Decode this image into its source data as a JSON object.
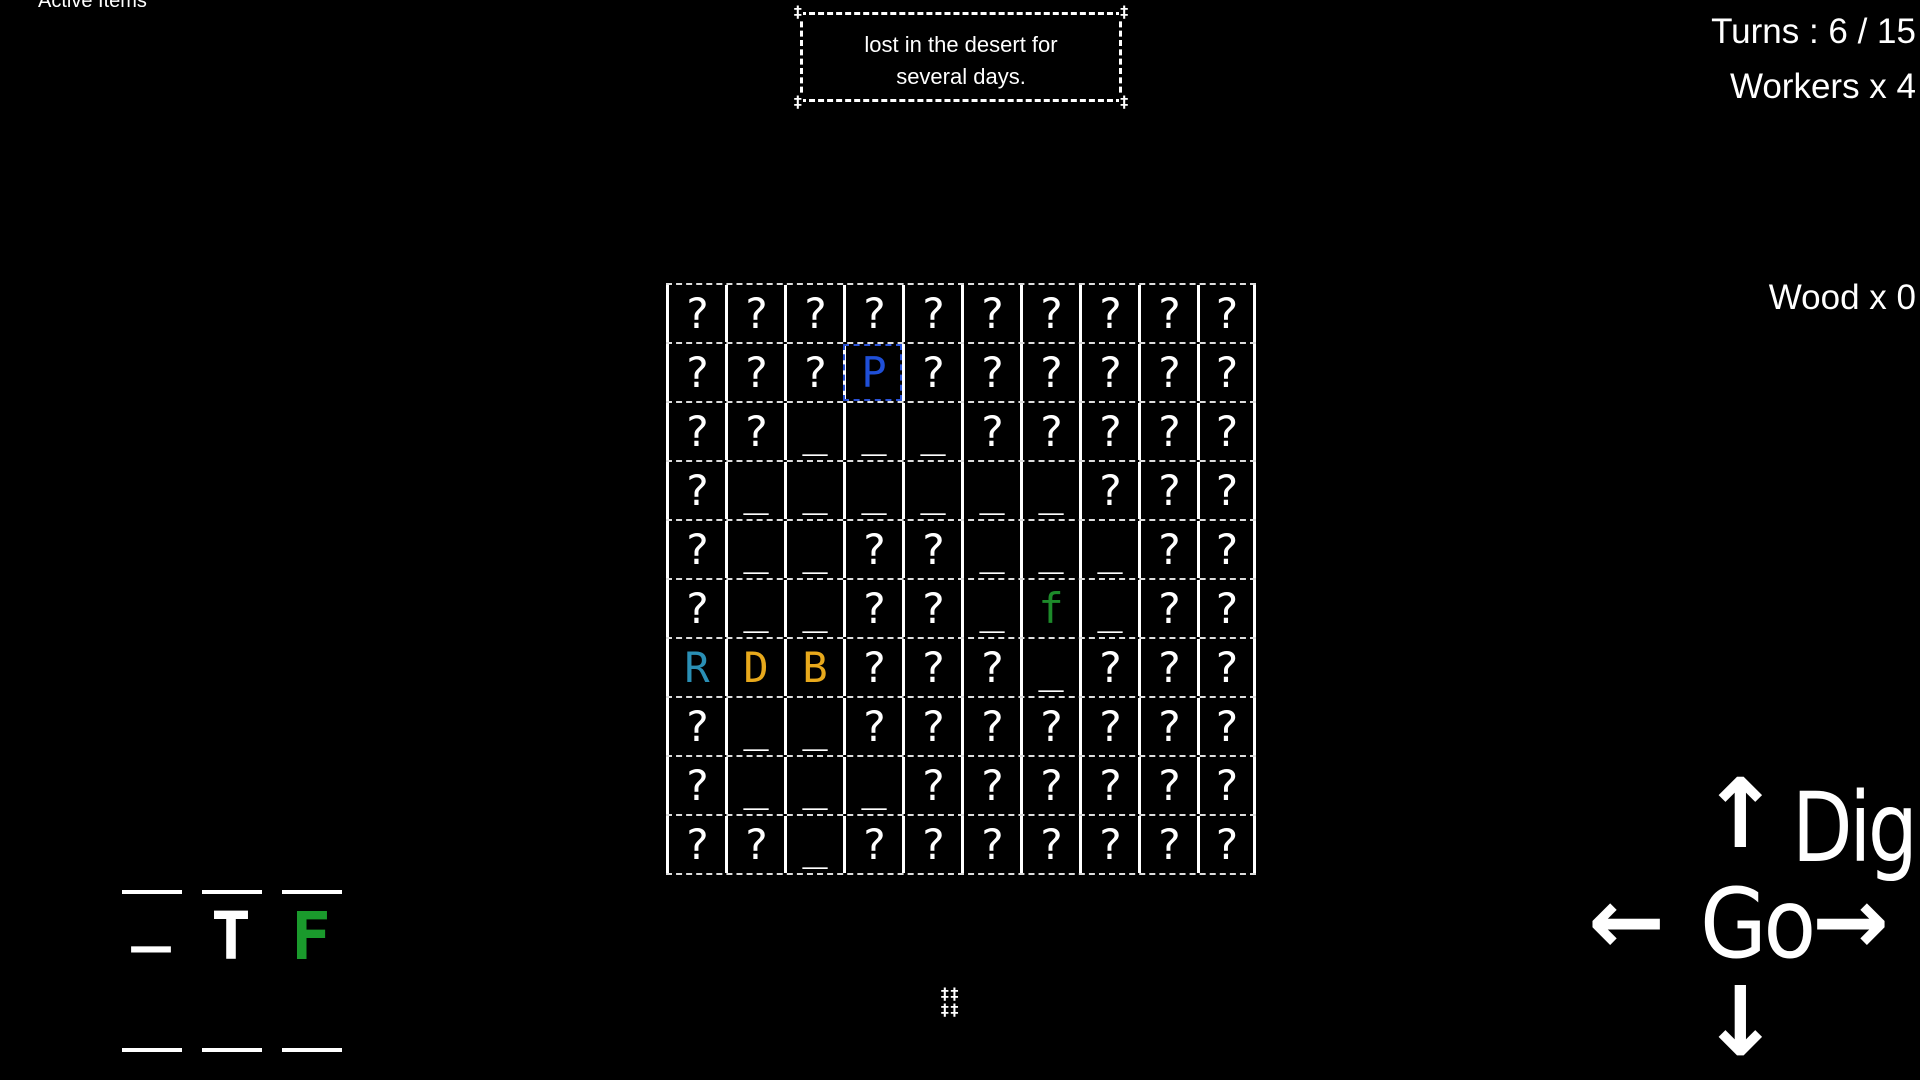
{
  "active_items_label": "Active Items",
  "message": {
    "text": "lost in the desert for several days.",
    "corner_glyph": "‡",
    "border_color": "#ffffff"
  },
  "stats": {
    "turns": "Turns : 6 / 15",
    "workers": "Workers x 4",
    "wood": "Wood x 0"
  },
  "grid": {
    "rows": [
      [
        "?",
        "?",
        "?",
        "?",
        "?",
        "?",
        "?",
        "?",
        "?",
        "?"
      ],
      [
        "?",
        "?",
        "?",
        "P",
        "?",
        "?",
        "?",
        "?",
        "?",
        "?"
      ],
      [
        "?",
        "?",
        "_",
        "_",
        "_",
        "?",
        "?",
        "?",
        "?",
        "?"
      ],
      [
        "?",
        "_",
        "_",
        "_",
        "_",
        "_",
        "_",
        "?",
        "?",
        "?"
      ],
      [
        "?",
        "_",
        "_",
        "?",
        "?",
        "_",
        "_",
        "_",
        "?",
        "?"
      ],
      [
        "?",
        "_",
        "_",
        "?",
        "?",
        "_",
        "f",
        "_",
        "?",
        "?"
      ],
      [
        "R",
        "D",
        "B",
        "?",
        "?",
        "?",
        "_",
        "?",
        "?",
        "?"
      ],
      [
        "?",
        "_",
        "_",
        "?",
        "?",
        "?",
        "?",
        "?",
        "?",
        "?"
      ],
      [
        "?",
        "_",
        "_",
        "_",
        "?",
        "?",
        "?",
        "?",
        "?",
        "?"
      ],
      [
        "?",
        "?",
        "_",
        "?",
        "?",
        "?",
        "?",
        "?",
        "?",
        "?"
      ]
    ],
    "cell_colors": {
      "P": "#1f4fd8",
      "f": "#1d8a2a",
      "R": "#2a8fb5",
      "D": "#e8a91c",
      "B": "#e8a91c"
    },
    "selected": [
      1,
      3
    ]
  },
  "inventory": {
    "slots": [
      "_",
      "T",
      "F"
    ],
    "slot_colors": [
      "#ffffff",
      "#ffffff",
      "#1a9a2c"
    ]
  },
  "controls": {
    "dig_label": "Dig",
    "go_label": "Go",
    "up_icon": "arrow-up-icon",
    "left_icon": "arrow-left-icon",
    "right_icon": "arrow-right-icon",
    "down_icon": "arrow-down-icon"
  },
  "marker_glyph": "‡‡"
}
